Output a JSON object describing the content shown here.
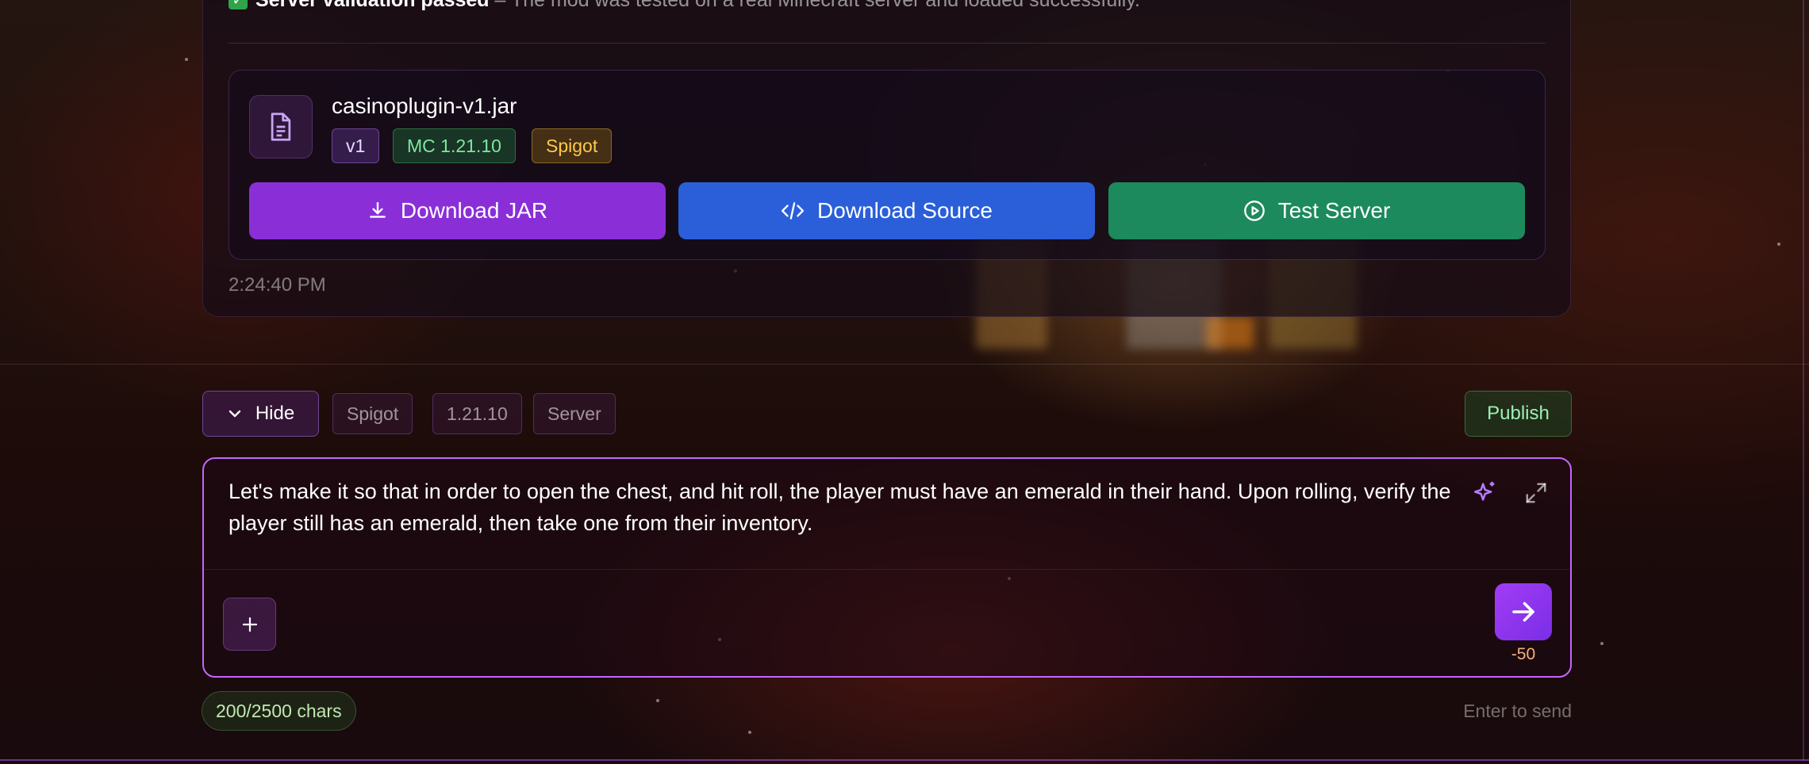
{
  "validation": {
    "check_icon": "✓",
    "title": "Server validation passed",
    "message": " – The mod was tested on a real Minecraft server and loaded successfully."
  },
  "file": {
    "icon": "file-text-icon",
    "name": "casinoplugin-v1.jar",
    "tags": {
      "version": "v1",
      "minecraft": "MC 1.21.10",
      "platform": "Spigot"
    }
  },
  "actions": {
    "download_jar": "Download JAR",
    "download_source": "Download Source",
    "test_server": "Test Server"
  },
  "message_time": "2:24:40 PM",
  "toolbar": {
    "hide_label": "Hide",
    "platform": "Spigot",
    "version": "1.21.10",
    "type": "Server",
    "publish_label": "Publish"
  },
  "composer": {
    "prompt": "Let's make it so that in order to open the chest, and hit roll, the player must have an emerald in their hand. Upon rolling, verify the player still has an emerald, then take one from their inventory.",
    "cost": "-50",
    "char_count": "200/2500 chars",
    "send_hint": "Enter to send"
  },
  "colors": {
    "accent_purple": "#8a2fd8",
    "source_blue": "#2a5fd9",
    "server_green": "#1c8a5c",
    "composer_border": "#c366ff"
  }
}
